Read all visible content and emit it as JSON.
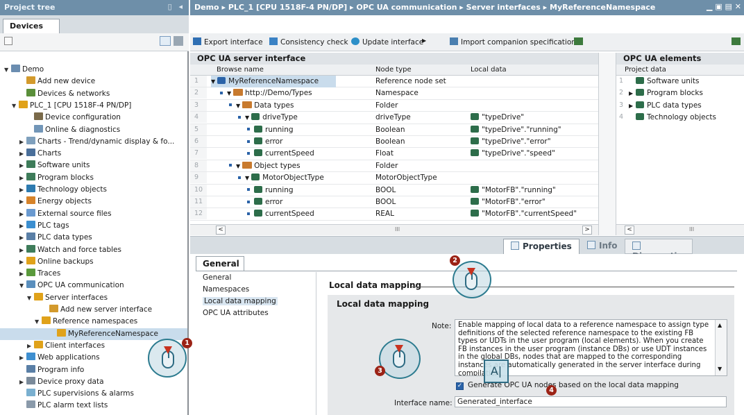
{
  "left_panel": {
    "title": "Project tree",
    "tab": "Devices",
    "tree": [
      {
        "label": "Demo",
        "indent": 0,
        "expand": "open",
        "icon": "project-icon",
        "color": "#6b8db0"
      },
      {
        "label": "Add new device",
        "indent": 2,
        "expand": "none",
        "icon": "add-device-icon",
        "color": "#d39a2c"
      },
      {
        "label": "Devices & networks",
        "indent": 2,
        "expand": "none",
        "icon": "network-icon",
        "color": "#5a8f3a"
      },
      {
        "label": "PLC_1 [CPU 1518F-4 PN/DP]",
        "indent": 1,
        "expand": "open",
        "icon": "plc-icon",
        "color": "#e0a21a"
      },
      {
        "label": "Device configuration",
        "indent": 3,
        "expand": "none",
        "icon": "device-config-icon",
        "color": "#7a6a4a"
      },
      {
        "label": "Online & diagnostics",
        "indent": 3,
        "expand": "none",
        "icon": "diagnostics-icon",
        "color": "#7296b8"
      },
      {
        "label": "Charts - Trend/dynamic display & fo...",
        "indent": 2,
        "expand": "closed",
        "icon": "charts-folder-icon",
        "color": "#7fa0bd"
      },
      {
        "label": "Charts",
        "indent": 2,
        "expand": "closed",
        "icon": "chart-icon",
        "color": "#4a6f9a"
      },
      {
        "label": "Software units",
        "indent": 2,
        "expand": "closed",
        "icon": "software-units-icon",
        "color": "#3e7c5a"
      },
      {
        "label": "Program blocks",
        "indent": 2,
        "expand": "closed",
        "icon": "program-blocks-icon",
        "color": "#3e7c5a"
      },
      {
        "label": "Technology objects",
        "indent": 2,
        "expand": "closed",
        "icon": "technology-objects-icon",
        "color": "#2d7bb0"
      },
      {
        "label": "Energy objects",
        "indent": 2,
        "expand": "closed",
        "icon": "energy-objects-icon",
        "color": "#d6832a"
      },
      {
        "label": "External source files",
        "indent": 2,
        "expand": "closed",
        "icon": "source-files-icon",
        "color": "#6a9ad0"
      },
      {
        "label": "PLC tags",
        "indent": 2,
        "expand": "closed",
        "icon": "plc-tags-icon",
        "color": "#3c8fd0"
      },
      {
        "label": "PLC data types",
        "indent": 2,
        "expand": "closed",
        "icon": "data-types-icon",
        "color": "#5a7fa6"
      },
      {
        "label": "Watch and force tables",
        "indent": 2,
        "expand": "closed",
        "icon": "watch-tables-icon",
        "color": "#3e7c5a"
      },
      {
        "label": "Online backups",
        "indent": 2,
        "expand": "closed",
        "icon": "backups-icon",
        "color": "#e0a21a"
      },
      {
        "label": "Traces",
        "indent": 2,
        "expand": "closed",
        "icon": "traces-icon",
        "color": "#5a9a3c"
      },
      {
        "label": "OPC UA communication",
        "indent": 2,
        "expand": "open",
        "icon": "opcua-icon",
        "color": "#5a8fbd"
      },
      {
        "label": "Server interfaces",
        "indent": 3,
        "expand": "open",
        "icon": "server-interfaces-icon",
        "color": "#e0a21a"
      },
      {
        "label": "Add new server interface",
        "indent": 5,
        "expand": "none",
        "icon": "add-interface-icon",
        "color": "#d39a2c"
      },
      {
        "label": "Reference namespaces",
        "indent": 4,
        "expand": "open",
        "icon": "namespace-folder-icon",
        "color": "#e0a21a"
      },
      {
        "label": "MyReferenceNamespace",
        "indent": 6,
        "expand": "none",
        "icon": "namespace-icon",
        "color": "#e0a21a",
        "selected": true
      },
      {
        "label": "Client interfaces",
        "indent": 3,
        "expand": "closed",
        "icon": "client-interfaces-icon",
        "color": "#e0a21a"
      },
      {
        "label": "Web applications",
        "indent": 2,
        "expand": "closed",
        "icon": "web-apps-icon",
        "color": "#3e8fd0"
      },
      {
        "label": "Program info",
        "indent": 2,
        "expand": "none",
        "icon": "program-info-icon",
        "color": "#5a7fa6"
      },
      {
        "label": "Device proxy data",
        "indent": 2,
        "expand": "closed",
        "icon": "proxy-data-icon",
        "color": "#7a8a9a"
      },
      {
        "label": "PLC supervisions & alarms",
        "indent": 2,
        "expand": "none",
        "icon": "alarms-icon",
        "color": "#7ab0d0"
      },
      {
        "label": "PLC alarm text lists",
        "indent": 2,
        "expand": "none",
        "icon": "alarm-text-icon",
        "color": "#8a9aaa"
      }
    ]
  },
  "main": {
    "breadcrumb": [
      "Demo",
      "PLC_1 [CPU 1518F-4 PN/DP]",
      "OPC UA communication",
      "Server interfaces",
      "MyReferenceNamespace"
    ],
    "toolbar": [
      "Export interface",
      "Consistency check",
      "Update interface",
      "Import companion specification"
    ],
    "server_panel": {
      "title": "OPC UA server interface",
      "columns": [
        "Browse name",
        "Node type",
        "Local data"
      ],
      "rows": [
        {
          "n": "1",
          "indent": 0,
          "icon": "root",
          "expand": "open",
          "name": "MyReferenceNamespace",
          "type": "Reference node set",
          "local": "",
          "selected": true
        },
        {
          "n": "2",
          "indent": 1,
          "icon": "opc",
          "expand": "open",
          "name": "http://Demo/Types",
          "type": "Namespace",
          "local": ""
        },
        {
          "n": "3",
          "indent": 2,
          "icon": "opc",
          "expand": "open",
          "name": "Data types",
          "type": "Folder",
          "local": ""
        },
        {
          "n": "4",
          "indent": 3,
          "icon": "udt",
          "expand": "open",
          "name": "driveType",
          "type": "driveType",
          "local": "\"typeDrive\""
        },
        {
          "n": "5",
          "indent": 4,
          "icon": "udt",
          "expand": "none",
          "name": "running",
          "type": "Boolean",
          "local": "\"typeDrive\".\"running\""
        },
        {
          "n": "6",
          "indent": 4,
          "icon": "udt",
          "expand": "none",
          "name": "error",
          "type": "Boolean",
          "local": "\"typeDrive\".\"error\""
        },
        {
          "n": "7",
          "indent": 4,
          "icon": "udt",
          "expand": "none",
          "name": "currentSpeed",
          "type": "Float",
          "local": "\"typeDrive\".\"speed\""
        },
        {
          "n": "8",
          "indent": 2,
          "icon": "opc",
          "expand": "open",
          "name": "Object types",
          "type": "Folder",
          "local": ""
        },
        {
          "n": "9",
          "indent": 3,
          "icon": "udt",
          "expand": "open",
          "name": "MotorObjectType",
          "type": "MotorObjectType",
          "local": ""
        },
        {
          "n": "10",
          "indent": 4,
          "icon": "udt",
          "expand": "none",
          "name": "running",
          "type": "BOOL",
          "local": "\"MotorFB\".\"running\""
        },
        {
          "n": "11",
          "indent": 4,
          "icon": "udt",
          "expand": "none",
          "name": "error",
          "type": "BOOL",
          "local": "\"MotorFB\".\"error\""
        },
        {
          "n": "12",
          "indent": 4,
          "icon": "udt",
          "expand": "none",
          "name": "currentSpeed",
          "type": "REAL",
          "local": "\"MotorFB\".\"currentSpeed\""
        }
      ]
    },
    "elements_panel": {
      "title": "OPC UA elements",
      "column": "Project data",
      "rows": [
        {
          "n": "1",
          "expand": "none",
          "label": "Software units"
        },
        {
          "n": "2",
          "expand": "closed",
          "label": "Program blocks"
        },
        {
          "n": "3",
          "expand": "closed",
          "label": "PLC data types"
        },
        {
          "n": "4",
          "expand": "none",
          "label": "Technology objects"
        }
      ]
    },
    "scroll_mid": "III"
  },
  "properties": {
    "tabs": [
      "Properties",
      "Info",
      "Diagnostics"
    ],
    "general_tab": "General",
    "nav": [
      "General",
      "Namespaces",
      "Local data mapping",
      "OPC UA attributes"
    ],
    "section_title": "Local data mapping",
    "box_title": "Local data mapping",
    "note_label": "Note:",
    "note_text": "Enable mapping of local data to a reference namespace to assign type definitions of the selected reference namespace to the existing FB types or UDTs in the user program (local elements). When you create FB instances in the user program (instance DBs) or use UDT instances in the global DBs, nodes that are mapped to the corresponding instances are automatically generated in the server interface during compilation.",
    "checkbox_label": "Generate OPC UA nodes based on the local data mapping",
    "checkbox_checked": true,
    "interface_label": "Interface name:",
    "interface_value": "Generated_interface"
  },
  "callouts": [
    {
      "num": "1"
    },
    {
      "num": "2"
    },
    {
      "num": "3"
    },
    {
      "num": "4"
    }
  ]
}
